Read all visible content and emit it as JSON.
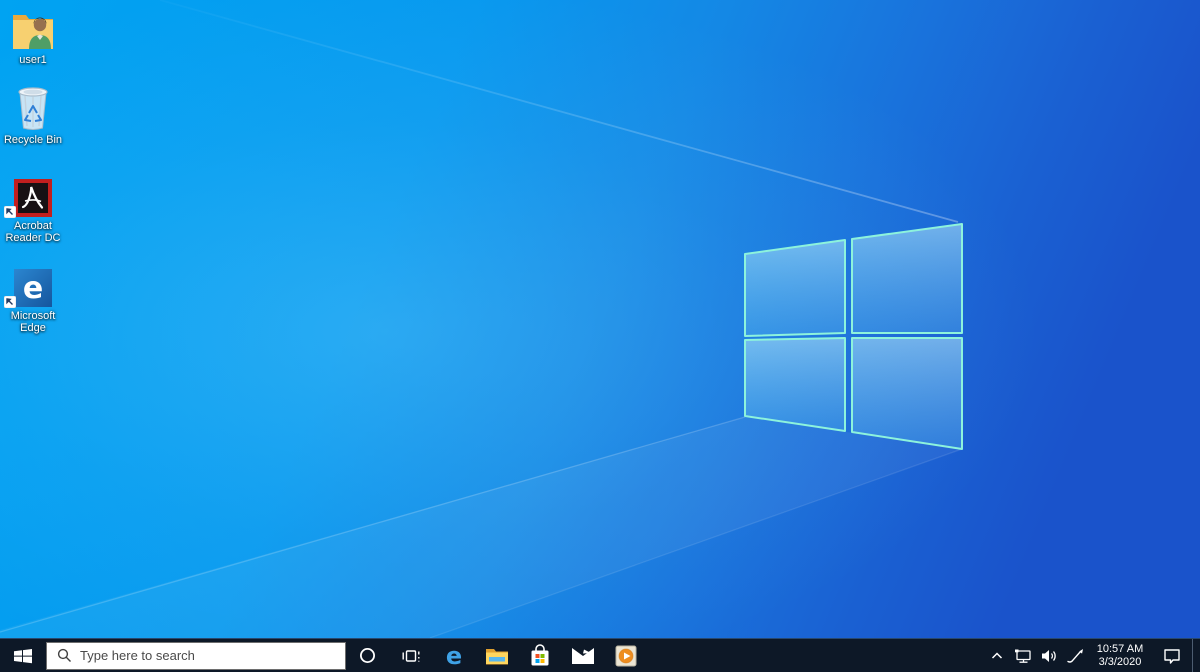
{
  "desktop": {
    "background_name": "windows10-light-wallpaper",
    "icons": [
      {
        "label": "user1",
        "icon": "user-folder-icon"
      },
      {
        "label": "Recycle Bin",
        "icon": "recycle-bin-icon"
      },
      {
        "label": "Acrobat Reader DC",
        "icon": "acrobat-reader-icon",
        "shortcut": true
      },
      {
        "label": "Microsoft Edge",
        "icon": "edge-icon",
        "shortcut": true
      }
    ]
  },
  "taskbar": {
    "start": {
      "icon": "windows-start-icon"
    },
    "search": {
      "placeholder": "Type here to search",
      "icon": "search-icon"
    },
    "apps": [
      {
        "icon": "cortana-icon"
      },
      {
        "icon": "task-view-icon"
      },
      {
        "icon": "edge-icon"
      },
      {
        "icon": "file-explorer-icon"
      },
      {
        "icon": "microsoft-store-icon"
      },
      {
        "icon": "mail-icon"
      },
      {
        "icon": "media-player-icon"
      }
    ],
    "tray": {
      "icons": [
        "hidden-icons-chevron-icon",
        "network-icon",
        "volume-icon",
        "pen-icon",
        "action-center-icon"
      ],
      "time": "10:57 AM",
      "date": "3/3/2020"
    }
  },
  "colors": {
    "wallpaper_left": "#00a3f2",
    "wallpaper_right": "#1a55cc",
    "logo_edge": "#8df3dc",
    "taskbar": "#0d1827",
    "store_red": "#f25022",
    "store_green": "#7fba00",
    "store_blue": "#00a4ef",
    "store_yellow": "#ffb900"
  }
}
